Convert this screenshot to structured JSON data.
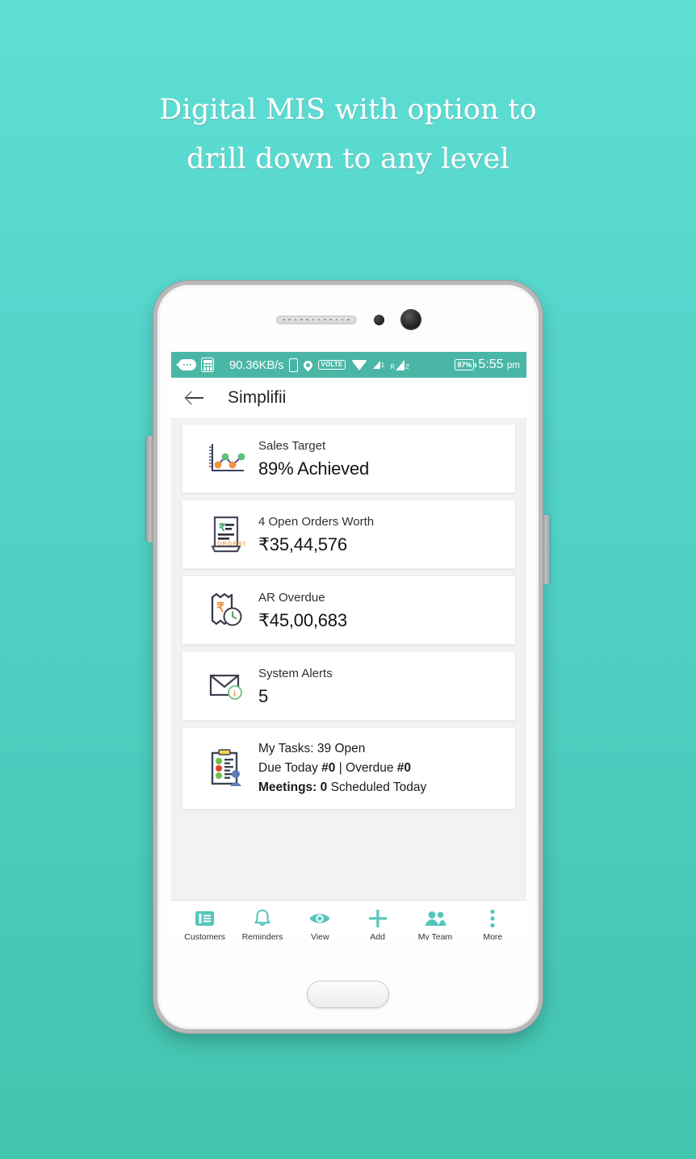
{
  "theme": {
    "bg_top": "#5ddfd4",
    "bg_bottom": "#42c4ae",
    "accent": "#56c6bb",
    "statusbar_bg": "#4ab7a6",
    "screen_bg": "#f2f2f2"
  },
  "headline": {
    "line1": "Digital MIS with option to",
    "line2": "drill down to any level"
  },
  "statusbar": {
    "network_speed": "90.36KB/s",
    "volte_label": "VOLTE",
    "sim1_label": "1",
    "roaming_label": "R",
    "sim2_label": "2",
    "battery": "87%",
    "time": "5:55",
    "meridiem": "pm"
  },
  "appbar": {
    "title": "Simplifii",
    "back_label": "Back"
  },
  "cards": [
    {
      "icon": "line-chart-icon",
      "label": "Sales Target",
      "value": "89% Achieved"
    },
    {
      "icon": "orders-document-icon",
      "label": "4 Open Orders Worth",
      "value": "₹35,44,576"
    },
    {
      "icon": "invoice-clock-icon",
      "label": "AR Overdue",
      "value": "₹45,00,683"
    },
    {
      "icon": "envelope-alert-icon",
      "label": "System Alerts",
      "value": "5"
    }
  ],
  "tasks_card": {
    "icon": "clipboard-person-icon",
    "line1": "My Tasks: 39 Open",
    "line2_a": "Due Today ",
    "line2_b": "#0",
    "line2_c": " | Overdue ",
    "line2_d": "#0",
    "line3_a": "Meetings: 0",
    "line3_b": " Scheduled Today"
  },
  "bottom_nav": [
    {
      "icon": "customers-icon",
      "label": "Customers"
    },
    {
      "icon": "bell-icon",
      "label": "Reminders"
    },
    {
      "icon": "eye-icon",
      "label": "View"
    },
    {
      "icon": "plus-icon",
      "label": "Add"
    },
    {
      "icon": "people-icon",
      "label": "My Team"
    },
    {
      "icon": "more-vertical-icon",
      "label": "More"
    }
  ]
}
